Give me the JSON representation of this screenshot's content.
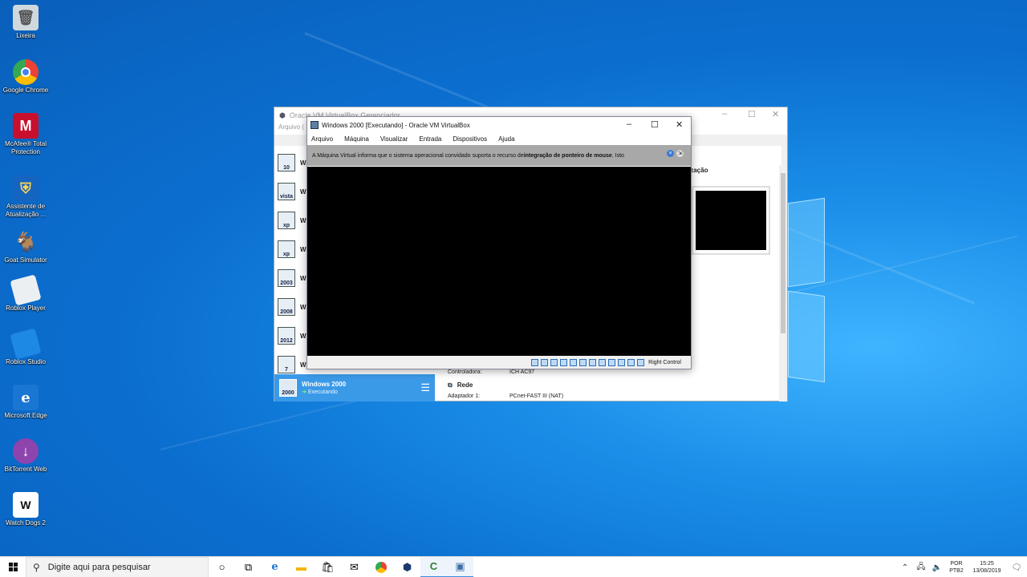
{
  "desktop": {
    "icons": [
      {
        "label": "Lixeira",
        "icon": "recycle-bin-icon",
        "color": "#cfd8dc"
      },
      {
        "label": "Google Chrome",
        "icon": "chrome-icon",
        "color": "#34a853"
      },
      {
        "label": "McAfee® Total Protection",
        "icon": "mcafee-icon",
        "color": "#c8102e"
      },
      {
        "label": "Assistente de Atualização ...",
        "icon": "update-assistant-icon",
        "color": "#1e88e5"
      },
      {
        "label": "Goat Simulator",
        "icon": "goat-simulator-icon",
        "color": "#263238"
      },
      {
        "label": "Roblox Player",
        "icon": "roblox-player-icon",
        "color": "#e0e0e0"
      },
      {
        "label": "Roblox Studio",
        "icon": "roblox-studio-icon",
        "color": "#1e88e5"
      },
      {
        "label": "Microsoft Edge",
        "icon": "edge-icon",
        "color": "#1976d2"
      },
      {
        "label": "BitTorrent Web",
        "icon": "bittorrent-icon",
        "color": "#8e44ad"
      },
      {
        "label": "Watch Dogs 2",
        "icon": "watchdogs-icon",
        "color": "#ffffff"
      }
    ]
  },
  "manager": {
    "title": "Oracle VM VirtualBox Gerenciador",
    "menu_partial": "Arquivo (",
    "vms": [
      {
        "initial": "W",
        "badge": "10"
      },
      {
        "initial": "W",
        "badge": "vista"
      },
      {
        "initial": "W",
        "badge": "xp"
      },
      {
        "initial": "W",
        "badge": "xp"
      },
      {
        "initial": "W",
        "badge": "2003"
      },
      {
        "initial": "W",
        "badge": "2008"
      },
      {
        "initial": "W",
        "badge": "2012"
      },
      {
        "initial": "W",
        "badge": "7"
      }
    ],
    "selected": {
      "name": "Windows 2000",
      "state": "Executando",
      "badge": "2000"
    },
    "details_heading": "ização",
    "controller_label": "Controladora:",
    "controller_value": "ICH AC97",
    "network_section": "Rede",
    "adapter_label": "Adaptador 1:",
    "adapter_value": "PCnet-FAST III (NAT)"
  },
  "vmwindow": {
    "title": "Windows 2000 [Executando] - Oracle VM VirtualBox",
    "menus": [
      "Arquivo",
      "Máquina",
      "Visualizar",
      "Entrada",
      "Dispositivos",
      "Ajuda"
    ],
    "notice_prefix": "A Máquina Virtual informa que o sistema operacional convidado suporta o recurso de ",
    "notice_bold": "integração de ponteiro de mouse",
    "notice_suffix": ". Isto",
    "host_key": "Right Control"
  },
  "taskbar": {
    "search_placeholder": "Digite aqui para pesquisar",
    "apps": [
      "cortana-icon",
      "task-view-icon",
      "edge-icon",
      "file-explorer-icon",
      "store-icon",
      "mail-icon",
      "chrome-icon",
      "virtualbox-icon",
      "camtasia-icon",
      "vm-window-icon"
    ],
    "lang_line1": "POR",
    "lang_line2": "PTB2",
    "time": "15:25",
    "date": "13/08/2019"
  }
}
